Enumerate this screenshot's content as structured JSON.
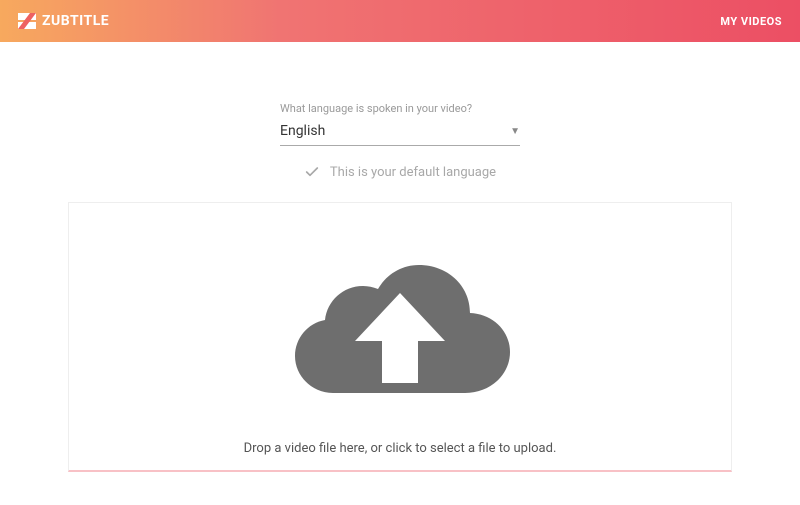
{
  "header": {
    "brand": "ZUBTITLE",
    "nav_my_videos": "MY VIDEOS"
  },
  "language_section": {
    "label": "What language is spoken in your video?",
    "selected_value": "English",
    "default_message": "This is your default language"
  },
  "dropzone": {
    "prompt": "Drop a video file here, or click to select a file to upload."
  }
}
